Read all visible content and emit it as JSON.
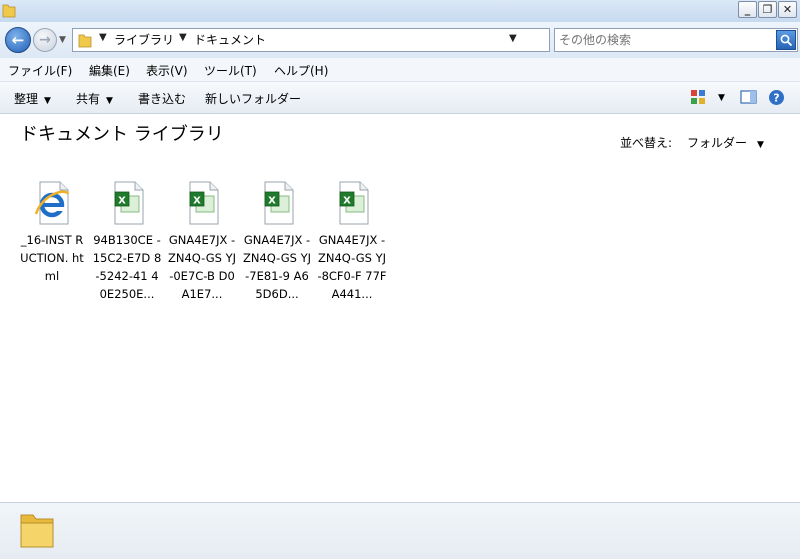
{
  "window": {
    "minimize_label": "_",
    "maximize_label": "❐",
    "close_label": "✕"
  },
  "nav": {
    "breadcrumb": [
      "ライブラリ",
      "ドキュメント"
    ],
    "search_placeholder": "その他の検索"
  },
  "menu": {
    "items": [
      "ファイル(F)",
      "編集(E)",
      "表示(V)",
      "ツール(T)",
      "ヘルプ(H)"
    ]
  },
  "commands": {
    "organize": "整理",
    "share": "共有",
    "burn": "書き込む",
    "new_folder": "新しいフォルダー"
  },
  "content": {
    "title": "ドキュメント ライブラリ",
    "sort_label": "並べ替え:",
    "sort_value": "フォルダー"
  },
  "files": [
    {
      "name": "_16-INSTRUCTION.html",
      "label": "_16-INST RUCTION. html",
      "type": "ie-html"
    },
    {
      "name": "94B130CE-15C2-E7D8-5242-4140E250E...",
      "label": "94B130CE -15C2-E7D 8-5242-41 40E250E...",
      "type": "excel"
    },
    {
      "name": "GNA4E7JX-ZN4Q-GSYJ-0E7C-BD0A1E7...",
      "label": "GNA4E7JX -ZN4Q-GS YJ-0E7C-B D0A1E7...",
      "type": "excel"
    },
    {
      "name": "GNA4E7JX-ZN4Q-GSYJ-7E81-9A65D6D...",
      "label": "GNA4E7JX -ZN4Q-GS YJ-7E81-9 A65D6D...",
      "type": "excel"
    },
    {
      "name": "GNA4E7JX-ZN4Q-GSYJ-8CF0-F77FA441...",
      "label": "GNA4E7JX -ZN4Q-GS YJ-8CF0-F 77FA441...",
      "type": "excel"
    }
  ],
  "colors": {
    "titlebar": "#c6daf0",
    "excel_green": "#1f7a2b",
    "ie_blue": "#1f6fc9",
    "folder_yellow": "#f0c94a"
  }
}
